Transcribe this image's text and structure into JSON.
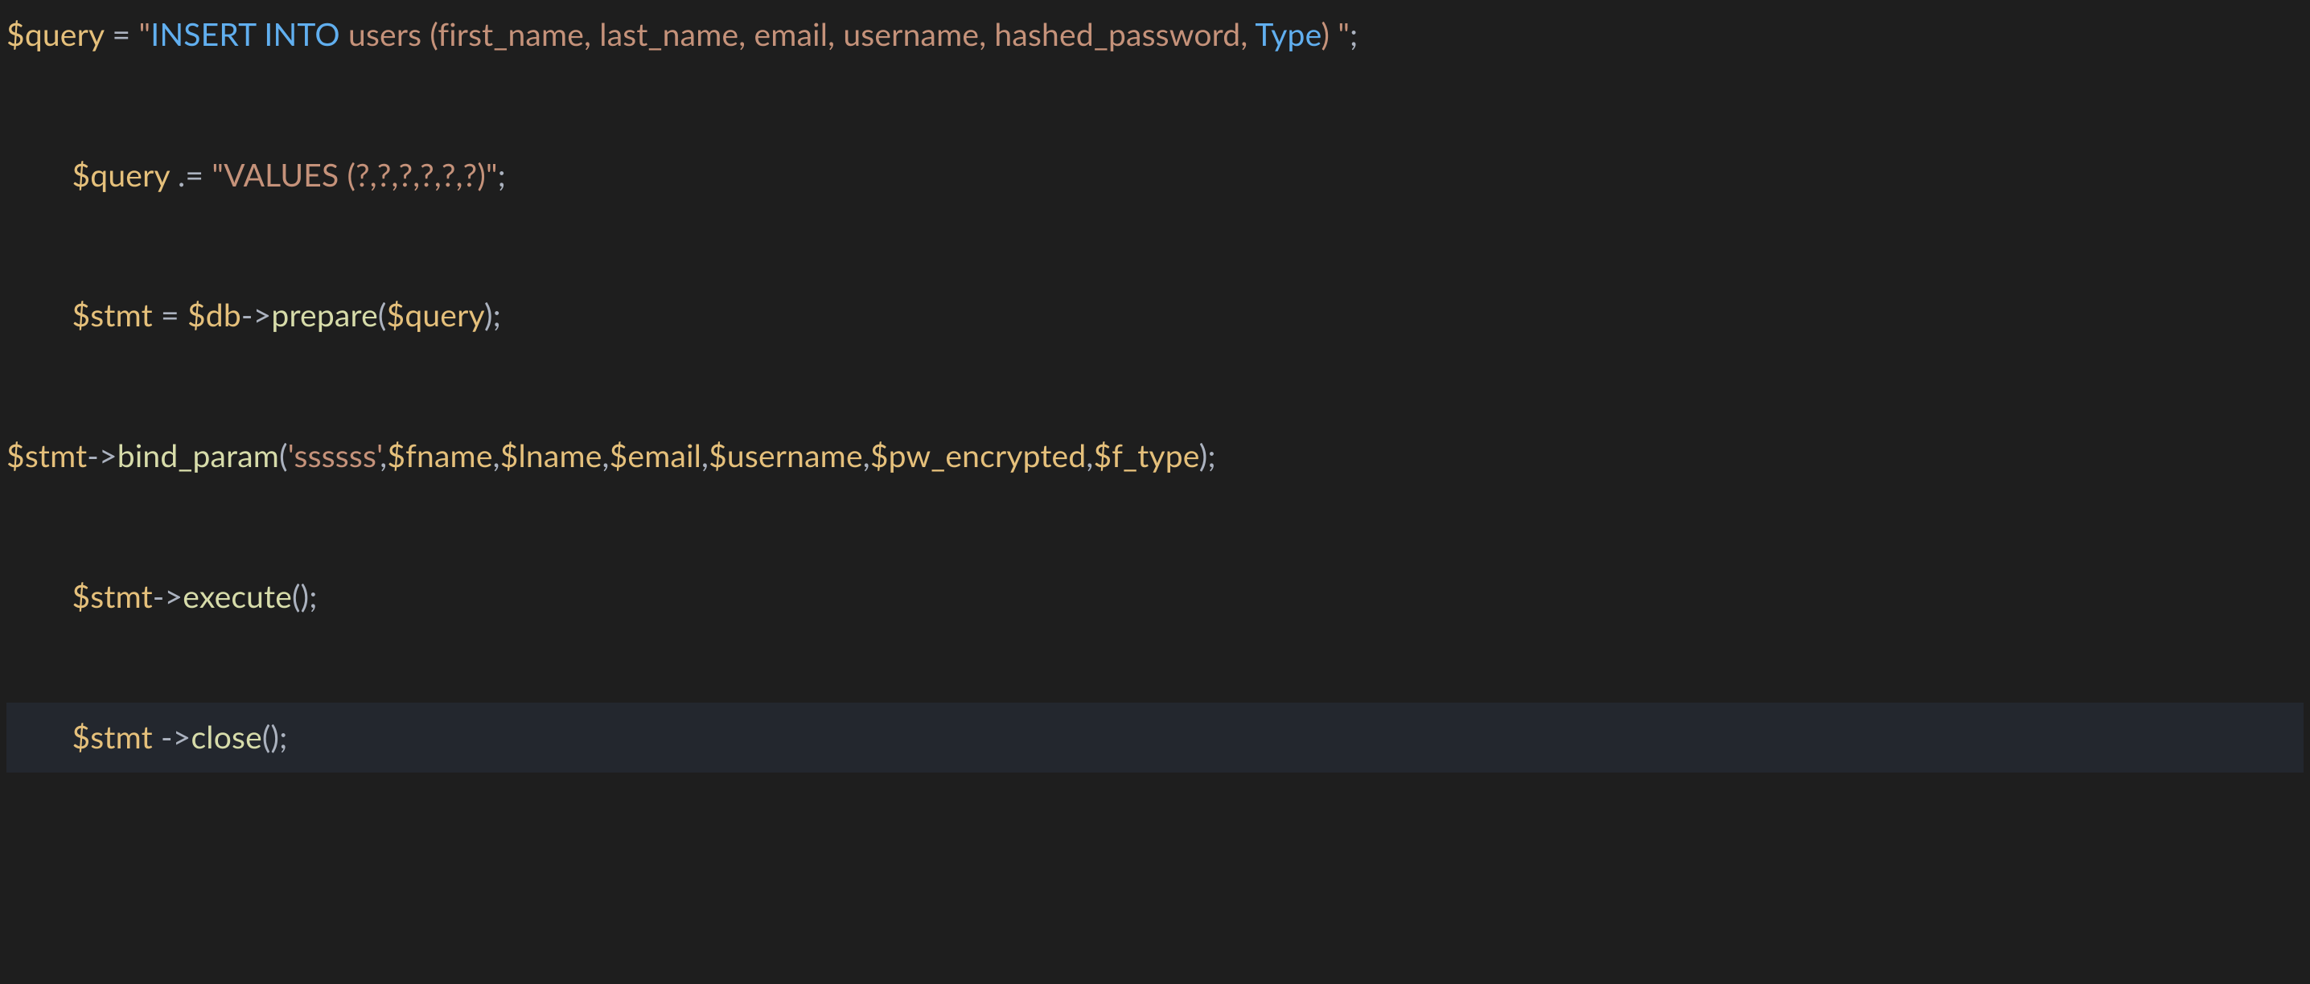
{
  "code": {
    "line1": {
      "var": "$query",
      "eq": " = ",
      "q1": "\"",
      "kw1": "INSERT INTO",
      "mid1": " users (first_name, last_name, email, username, hashed_password, ",
      "kw2": "Type",
      "mid2": ") ",
      "q2": "\"",
      "semi": ";"
    },
    "line3": {
      "indent": "        ",
      "var": "$query",
      "op": " .= ",
      "q1": "\"",
      "body": "VALUES (?,?,?,?,?,?)",
      "q2": "\"",
      "semi": ";"
    },
    "line5": {
      "indent": "        ",
      "var1": "$stmt",
      "eq": " = ",
      "var2": "$db",
      "arrow": "->",
      "call": "prepare",
      "open": "(",
      "arg": "$query",
      "close": ")",
      "semi": ";"
    },
    "line7": {
      "var": "$stmt",
      "arrow": "->",
      "call": "bind_param",
      "open": "(",
      "lit": "'ssssss'",
      "c1": ",",
      "a1": "$fname",
      "c2": ",",
      "a2": "$lname",
      "c3": ",",
      "a3": "$email",
      "c4": ",",
      "a4": "$username",
      "c5": ",",
      "a5": "$pw_encrypted",
      "c6": ",",
      "a6": "$f_type",
      "close": ")",
      "semi": ";"
    },
    "line9": {
      "indent": "        ",
      "var": "$stmt",
      "arrow": "->",
      "call": "execute",
      "parens": "()",
      "semi": ";"
    },
    "line11": {
      "indent": "        ",
      "var": "$stmt",
      "sp": " ",
      "arrow": "->",
      "call": "close",
      "parens": "()",
      "semi": ";"
    }
  }
}
